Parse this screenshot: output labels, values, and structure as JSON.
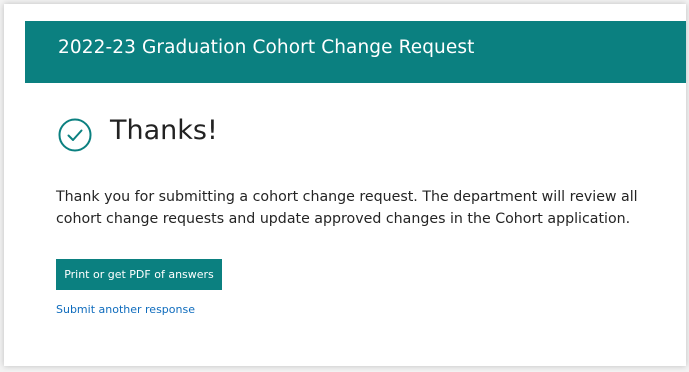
{
  "header": {
    "title": "2022-23 Graduation Cohort Change Request"
  },
  "confirmation": {
    "icon": "check-circle-icon",
    "heading": "Thanks!",
    "message": "Thank you for submitting a cohort change request. The department will review all cohort change requests and update approved changes in the Cohort application."
  },
  "actions": {
    "print_label": "Print or get PDF of answers",
    "another_label": "Submit another response"
  },
  "colors": {
    "accent": "#0b8080",
    "link": "#0f6cbd",
    "text": "#242424"
  }
}
